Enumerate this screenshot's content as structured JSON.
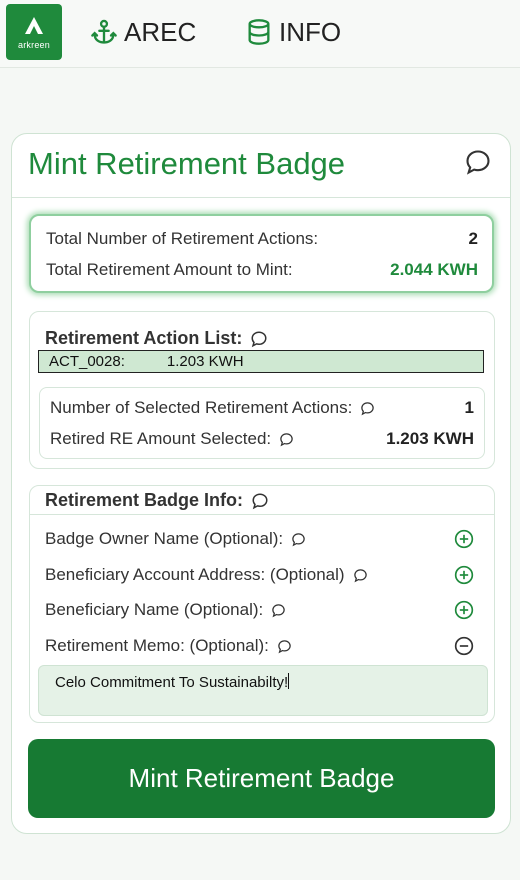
{
  "header": {
    "logo_text": "arkreen",
    "nav": [
      {
        "label": "AREC",
        "icon": "anchor-icon"
      },
      {
        "label": "INFO",
        "icon": "database-icon"
      }
    ]
  },
  "card": {
    "title": "Mint Retirement Badge",
    "summary": {
      "total_actions_label": "Total Number of Retirement Actions:",
      "total_actions_value": "2",
      "total_amount_label": "Total Retirement Amount to Mint:",
      "total_amount_value": "2.044 KWH"
    },
    "action_list": {
      "title": "Retirement Action List:",
      "items": [
        {
          "id": "ACT_0028:",
          "amount": "1.203 KWH"
        }
      ],
      "selected_count_label": "Number of Selected Retirement Actions:",
      "selected_count_value": "1",
      "selected_amount_label": "Retired RE Amount Selected:",
      "selected_amount_value": "1.203 KWH"
    },
    "badge_info": {
      "title": "Retirement Badge Info:",
      "fields": [
        {
          "label": "Badge Owner Name (Optional):",
          "state": "collapsed"
        },
        {
          "label": "Beneficiary Account Address: (Optional)",
          "state": "collapsed"
        },
        {
          "label": "Beneficiary Name (Optional):",
          "state": "collapsed"
        },
        {
          "label": "Retirement Memo: (Optional):",
          "state": "expanded"
        }
      ],
      "memo_value": "Celo Commitment To Sustainabilty!"
    },
    "mint_button_label": "Mint Retirement Badge"
  },
  "colors": {
    "brand_green": "#1f8a3c",
    "button_green": "#177a33",
    "highlight_row": "#cfe8d2",
    "memo_bg": "#e5f2e7"
  }
}
